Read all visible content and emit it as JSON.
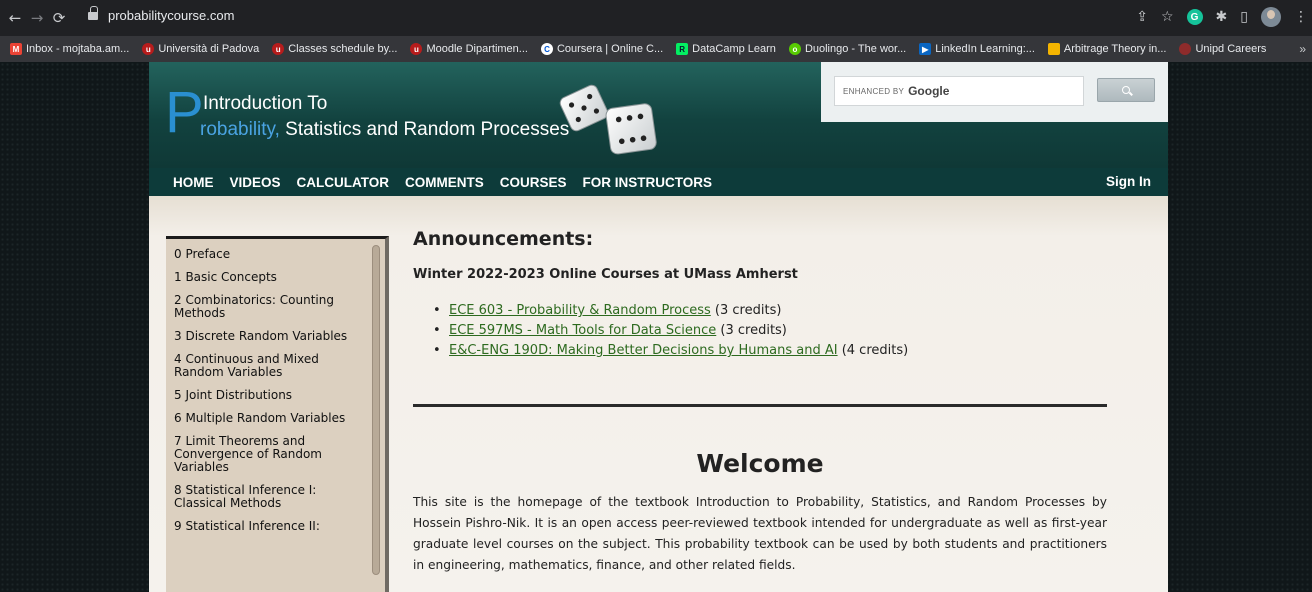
{
  "browser": {
    "url": "probabilitycourse.com",
    "bookmarks": [
      {
        "label": "Inbox - mojtaba.am...",
        "icon": "gmail-icon",
        "fav": "M"
      },
      {
        "label": "Università di Padova",
        "icon": "unipd-icon",
        "fav": "u"
      },
      {
        "label": "Classes schedule by...",
        "icon": "unipd-icon",
        "fav": "u"
      },
      {
        "label": "Moodle Dipartimen...",
        "icon": "unipd-icon",
        "fav": "u"
      },
      {
        "label": "Coursera | Online C...",
        "icon": "coursera-icon",
        "fav": "C"
      },
      {
        "label": "DataCamp Learn",
        "icon": "datacamp-icon",
        "fav": "R"
      },
      {
        "label": "Duolingo - The wor...",
        "icon": "duolingo-icon",
        "fav": "o"
      },
      {
        "label": "LinkedIn Learning:...",
        "icon": "linkedin-learning-icon",
        "fav": "▶"
      },
      {
        "label": "Arbitrage Theory in...",
        "icon": "arbitrage-icon",
        "fav": ""
      },
      {
        "label": "Unipd Careers",
        "icon": "careers-icon",
        "fav": ""
      }
    ],
    "more_label": "»"
  },
  "header": {
    "logo_p": "P",
    "logo_line1": "Introduction To",
    "logo_line2_prob": "robability,",
    "logo_line2_rest": " Statistics and Random Processes",
    "search_enhanced": "ENHANCED BY",
    "search_google": "Google"
  },
  "nav": {
    "items": [
      "HOME",
      "VIDEOS",
      "CALCULATOR",
      "COMMENTS",
      "COURSES",
      "FOR INSTRUCTORS"
    ],
    "sign_in": "Sign In"
  },
  "sidebar": {
    "items": [
      "0 Preface",
      "1 Basic Concepts",
      "2 Combinatorics: Counting Methods",
      "3 Discrete Random Variables",
      "4 Continuous and Mixed Random Variables",
      "5 Joint Distributions",
      "6 Multiple Random Variables",
      "7 Limit Theorems and Convergence of Random Variables",
      "8 Statistical Inference I: Classical Methods",
      "9 Statistical Inference II:"
    ]
  },
  "main": {
    "announcements_title": "Announcements:",
    "announcements_sub": "Winter 2022-2023 Online Courses at UMass Amherst",
    "courses": [
      {
        "link": "ECE 603 - Probability & Random Process",
        "credits": " (3 credits)"
      },
      {
        "link": "ECE 597MS - Math Tools for Data Science",
        "credits": " (3 credits)"
      },
      {
        "link": "E&C-ENG 190D: Making Better Decisions by Humans and AI",
        "credits": " (4 credits)"
      }
    ],
    "welcome_title": "Welcome",
    "welcome_text": "This site is the homepage of the textbook Introduction to Probability, Statistics, and Random Processes by Hossein Pishro-Nik. It is an open access peer-reviewed textbook intended for undergraduate as well as first-year graduate level courses on the subject. This probability textbook can be used by both students and practitioners in engineering, mathematics, finance, and other related fields."
  }
}
